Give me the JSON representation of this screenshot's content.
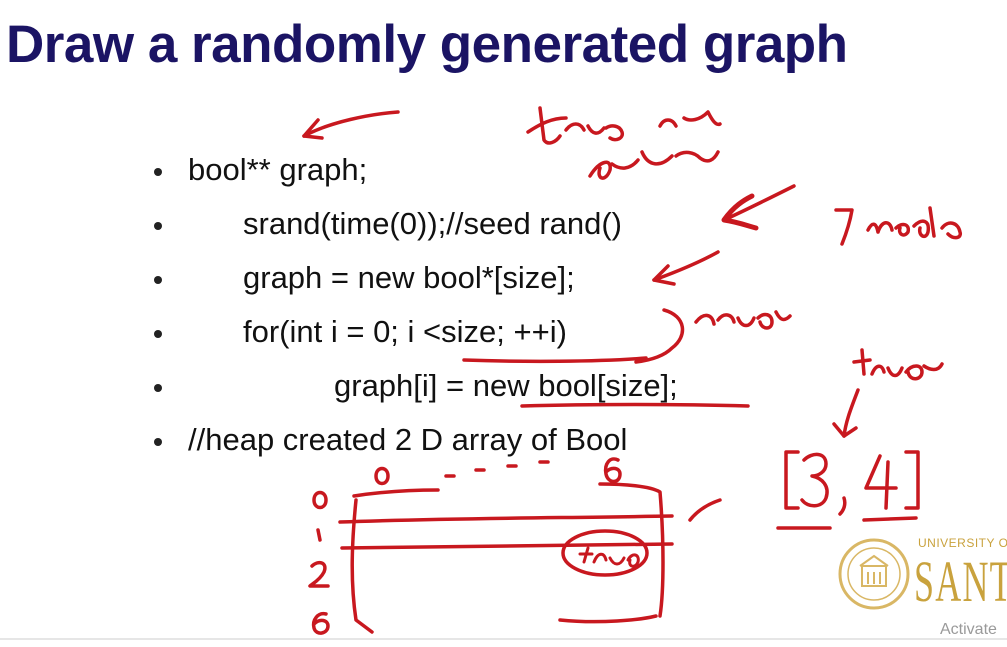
{
  "slide": {
    "title": "Draw a randomly generated graph",
    "lines": [
      "bool** graph;",
      "srand(time(0));//seed rand()",
      "graph = new bool*[size];",
      "for(int i = 0; i <size; ++i)",
      "graph[i] = new bool[size];",
      "//heap created 2 D array of Bool"
    ]
  },
  "logo": {
    "caption": "UNIVERSITY OF",
    "name": "SANTA"
  },
  "watermark": "Activate",
  "colors": {
    "title": "#1b1464",
    "ink": "#c8181f",
    "logo": "#c9a23d"
  }
}
